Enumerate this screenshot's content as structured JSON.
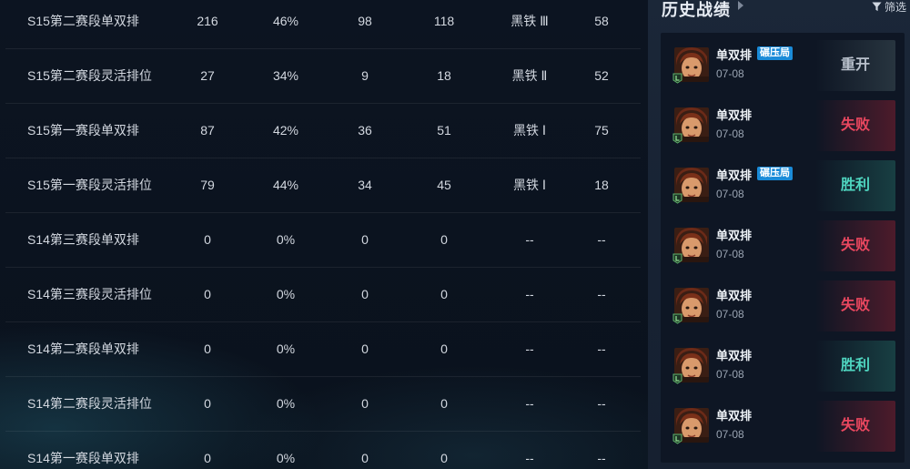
{
  "ranked_table": {
    "rows": [
      {
        "season": "S15第二赛段单双排",
        "games": "216",
        "winrate": "46%",
        "wins": "98",
        "losses": "118",
        "tier": "黑铁 Ⅲ",
        "points": "58"
      },
      {
        "season": "S15第二赛段灵活排位",
        "games": "27",
        "winrate": "34%",
        "wins": "9",
        "losses": "18",
        "tier": "黑铁 Ⅱ",
        "points": "52"
      },
      {
        "season": "S15第一赛段单双排",
        "games": "87",
        "winrate": "42%",
        "wins": "36",
        "losses": "51",
        "tier": "黑铁 Ⅰ",
        "points": "75"
      },
      {
        "season": "S15第一赛段灵活排位",
        "games": "79",
        "winrate": "44%",
        "wins": "34",
        "losses": "45",
        "tier": "黑铁 Ⅰ",
        "points": "18"
      },
      {
        "season": "S14第三赛段单双排",
        "games": "0",
        "winrate": "0%",
        "wins": "0",
        "losses": "0",
        "tier": "--",
        "points": "--"
      },
      {
        "season": "S14第三赛段灵活排位",
        "games": "0",
        "winrate": "0%",
        "wins": "0",
        "losses": "0",
        "tier": "--",
        "points": "--"
      },
      {
        "season": "S14第二赛段单双排",
        "games": "0",
        "winrate": "0%",
        "wins": "0",
        "losses": "0",
        "tier": "--",
        "points": "--"
      },
      {
        "season": "S14第二赛段灵活排位",
        "games": "0",
        "winrate": "0%",
        "wins": "0",
        "losses": "0",
        "tier": "--",
        "points": "--"
      },
      {
        "season": "S14第一赛段单双排",
        "games": "0",
        "winrate": "0%",
        "wins": "0",
        "losses": "0",
        "tier": "--",
        "points": "--"
      }
    ]
  },
  "history": {
    "title": "历史战绩",
    "filter_label": "筛选",
    "matches": [
      {
        "mode": "单双排",
        "tag": "碾压局",
        "date": "07-08",
        "result": "重开",
        "result_type": "remake"
      },
      {
        "mode": "单双排",
        "tag": "",
        "date": "07-08",
        "result": "失败",
        "result_type": "lose"
      },
      {
        "mode": "单双排",
        "tag": "碾压局",
        "date": "07-08",
        "result": "胜利",
        "result_type": "win"
      },
      {
        "mode": "单双排",
        "tag": "",
        "date": "07-08",
        "result": "失败",
        "result_type": "lose"
      },
      {
        "mode": "单双排",
        "tag": "",
        "date": "07-08",
        "result": "失败",
        "result_type": "lose"
      },
      {
        "mode": "单双排",
        "tag": "",
        "date": "07-08",
        "result": "胜利",
        "result_type": "win"
      },
      {
        "mode": "单双排",
        "tag": "",
        "date": "07-08",
        "result": "失败",
        "result_type": "lose"
      }
    ]
  },
  "colors": {
    "win": "#4fd6c0",
    "lose": "#e9475f",
    "remake": "#b8c0cb",
    "tag_bg": "#1a8bd8"
  }
}
